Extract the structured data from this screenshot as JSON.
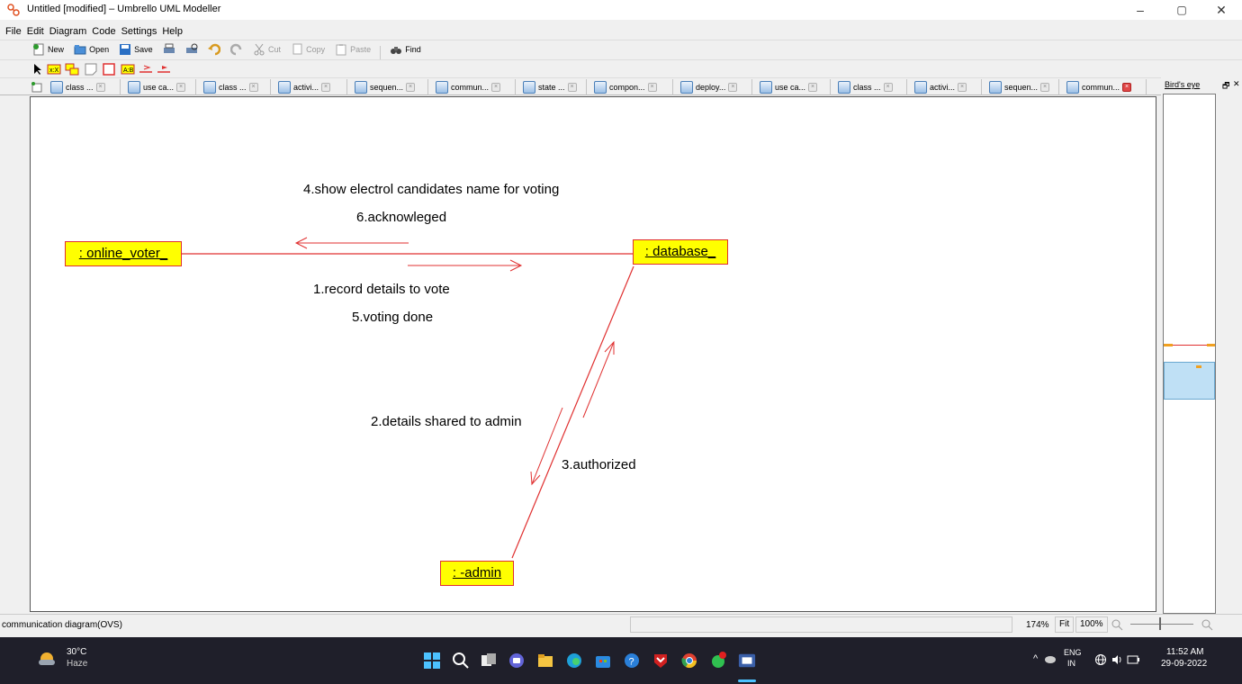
{
  "window": {
    "title": "Untitled [modified] – Umbrello UML Modeller",
    "minimize": "–",
    "restore": "▢",
    "close": "✕"
  },
  "menu": [
    "File",
    "Edit",
    "Diagram",
    "Code",
    "Settings",
    "Help"
  ],
  "toolbar": {
    "new": "New",
    "open": "Open",
    "save": "Save",
    "cut": "Cut",
    "copy": "Copy",
    "paste": "Paste",
    "find": "Find"
  },
  "tabs": [
    {
      "label": "class ...",
      "icon": "class-diagram-icon"
    },
    {
      "label": "use ca...",
      "icon": "usecase-diagram-icon"
    },
    {
      "label": "class ...",
      "icon": "class-diagram-icon"
    },
    {
      "label": "activi...",
      "icon": "activity-diagram-icon"
    },
    {
      "label": "sequen...",
      "icon": "sequence-diagram-icon"
    },
    {
      "label": "commun...",
      "icon": "communication-diagram-icon"
    },
    {
      "label": "state ...",
      "icon": "state-diagram-icon"
    },
    {
      "label": "compon...",
      "icon": "component-diagram-icon"
    },
    {
      "label": "deploy...",
      "icon": "deployment-diagram-icon"
    },
    {
      "label": "use ca...",
      "icon": "usecase-diagram-icon"
    },
    {
      "label": "class ...",
      "icon": "class-diagram-icon"
    },
    {
      "label": "activi...",
      "icon": "activity-diagram-icon"
    },
    {
      "label": "sequen...",
      "icon": "sequence-diagram-icon"
    },
    {
      "label": "commun...",
      "icon": "communication-diagram-icon"
    }
  ],
  "birds_eye": {
    "title": "Bird's eye"
  },
  "diagram": {
    "objects": {
      "online_voter": ": online_voter_",
      "database": ": database_",
      "admin": ": -admin"
    },
    "messages": {
      "m4": "4.show electrol candidates name for voting",
      "m6": "6.acknowleged",
      "m1": "1.record details to vote",
      "m5": "5.voting done",
      "m2": "2.details shared to admin",
      "m3": "3.authorized"
    },
    "line_color": "#e03030",
    "object_fill": "#ffff00"
  },
  "status": {
    "diagram_name": "communication diagram(OVS)",
    "zoom": "174%",
    "fit": "Fit",
    "hundred": "100%"
  },
  "taskbar": {
    "weather_temp": "30°C",
    "weather_desc": "Haze",
    "lang": "ENG",
    "region": "IN",
    "time": "11:52 AM",
    "date": "29-09-2022"
  }
}
